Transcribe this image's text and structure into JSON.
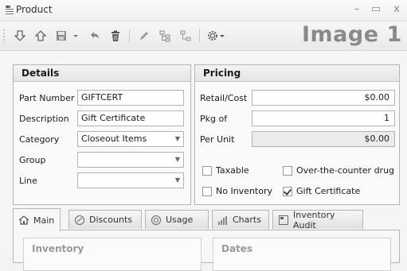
{
  "window": {
    "title": "Product",
    "min_glyph": "–",
    "max_glyph": "▭",
    "close_glyph": "x"
  },
  "toolbar": {
    "image_label": "Image 1",
    "icons": [
      "arrow-down-icon",
      "arrow-up-icon",
      "save-icon",
      "dropdown-arrow-icon",
      "undo-icon",
      "delete-icon",
      "pencil-icon",
      "tree-icon",
      "hierarchy-icon",
      "gear-icon"
    ]
  },
  "details": {
    "header": "Details",
    "part_number_label": "Part Number",
    "part_number_value": "GIFTCERT",
    "description_label": "Description",
    "description_value": "Gift Certificate",
    "category_label": "Category",
    "category_value": "Closeout Items",
    "group_label": "Group",
    "group_value": "",
    "line_label": "Line",
    "line_value": ""
  },
  "pricing": {
    "header": "Pricing",
    "retail_cost_label": "Retail/Cost",
    "retail_cost_value": "$0.00",
    "pkg_of_label": "Pkg of",
    "pkg_of_value": "1",
    "per_unit_label": "Per Unit",
    "per_unit_value": "$0.00",
    "taxable_label": "Taxable",
    "taxable_checked": false,
    "otc_label": "Over-the-counter drug",
    "otc_checked": false,
    "no_inventory_label": "No Inventory",
    "no_inventory_checked": false,
    "gift_cert_label": "Gift Certificate",
    "gift_cert_checked": true
  },
  "tabs": [
    {
      "label": "Main",
      "active": true
    },
    {
      "label": "Discounts",
      "active": false
    },
    {
      "label": "Usage",
      "active": false
    },
    {
      "label": "Charts",
      "active": false
    },
    {
      "label": "Inventory Audit",
      "active": false
    }
  ],
  "main_tab": {
    "inventory_header": "Inventory",
    "dates_header": "Dates"
  }
}
